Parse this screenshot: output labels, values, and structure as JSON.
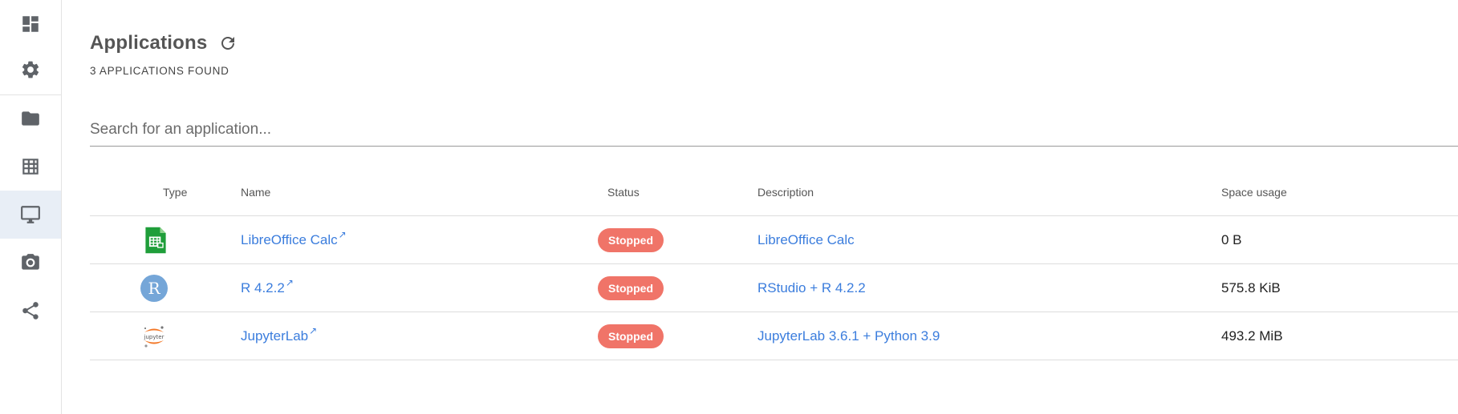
{
  "sidebar": {
    "items": [
      {
        "icon": "dashboard-icon"
      },
      {
        "icon": "gear-icon"
      },
      {
        "icon": "folder-icon"
      },
      {
        "icon": "table-icon"
      },
      {
        "icon": "monitor-icon",
        "active": true
      },
      {
        "icon": "camera-icon"
      },
      {
        "icon": "share-icon"
      }
    ]
  },
  "header": {
    "title": "Applications",
    "subtitle": "3 APPLICATIONS FOUND"
  },
  "search": {
    "placeholder": "Search for an application..."
  },
  "table": {
    "columns": {
      "type": "Type",
      "name": "Name",
      "status": "Status",
      "description": "Description",
      "space": "Space usage"
    },
    "rows": [
      {
        "type_icon": "libreoffice-calc-icon",
        "name": "LibreOffice Calc",
        "status": "Stopped",
        "description": "LibreOffice Calc",
        "space": "0 B"
      },
      {
        "type_icon": "r-icon",
        "name": "R 4.2.2",
        "status": "Stopped",
        "description": "RStudio + R 4.2.2",
        "space": "575.8 KiB"
      },
      {
        "type_icon": "jupyter-icon",
        "name": "JupyterLab",
        "status": "Stopped",
        "description": "JupyterLab 3.6.1 + Python 3.9",
        "space": "493.2 MiB"
      }
    ]
  },
  "colors": {
    "link": "#3b7ddd",
    "status_stopped": "#f07468",
    "active_nav_bg": "#e8eef6"
  }
}
